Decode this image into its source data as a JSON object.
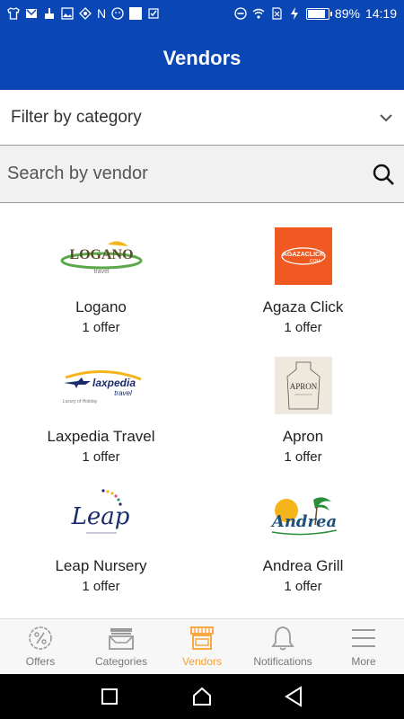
{
  "status_bar": {
    "battery_percent": "89%",
    "battery_level": 0.89,
    "time": "14:19",
    "network_letter": "N"
  },
  "header": {
    "title": "Vendors",
    "background": "#0b47b4"
  },
  "filter": {
    "label": "Filter by category",
    "icon": "chevron-down-icon"
  },
  "search": {
    "placeholder": "Search by vendor",
    "value": "",
    "icon": "search-icon"
  },
  "vendors": [
    {
      "name": "Logano",
      "offers": "1 offer",
      "logo_text": "LOGANO",
      "logo_subtext": "travel"
    },
    {
      "name": "Agaza Click",
      "offers": "1 offer",
      "logo_text": "AGAZACLICK",
      "logo_subtext": ".COM",
      "logo_color": "#f05a22"
    },
    {
      "name": "Laxpedia Travel",
      "offers": "1 offer",
      "logo_text": "laxpedia",
      "logo_subtext": "travel",
      "logo_tagline": "Luxury of Holiday"
    },
    {
      "name": "Apron",
      "offers": "1 offer",
      "logo_text": "APRON"
    },
    {
      "name": "Leap Nursery",
      "offers": "1 offer",
      "logo_text": "Leap"
    },
    {
      "name": "Andrea Grill",
      "offers": "1 offer",
      "logo_text": "Andrea"
    }
  ],
  "bottom_nav": {
    "active_color": "#f7a034",
    "items": [
      {
        "label": "Offers",
        "icon": "percent-badge-icon"
      },
      {
        "label": "Categories",
        "icon": "inbox-tray-icon"
      },
      {
        "label": "Vendors",
        "icon": "store-icon"
      },
      {
        "label": "Notifications",
        "icon": "bell-icon"
      },
      {
        "label": "More",
        "icon": "menu-icon"
      }
    ]
  }
}
